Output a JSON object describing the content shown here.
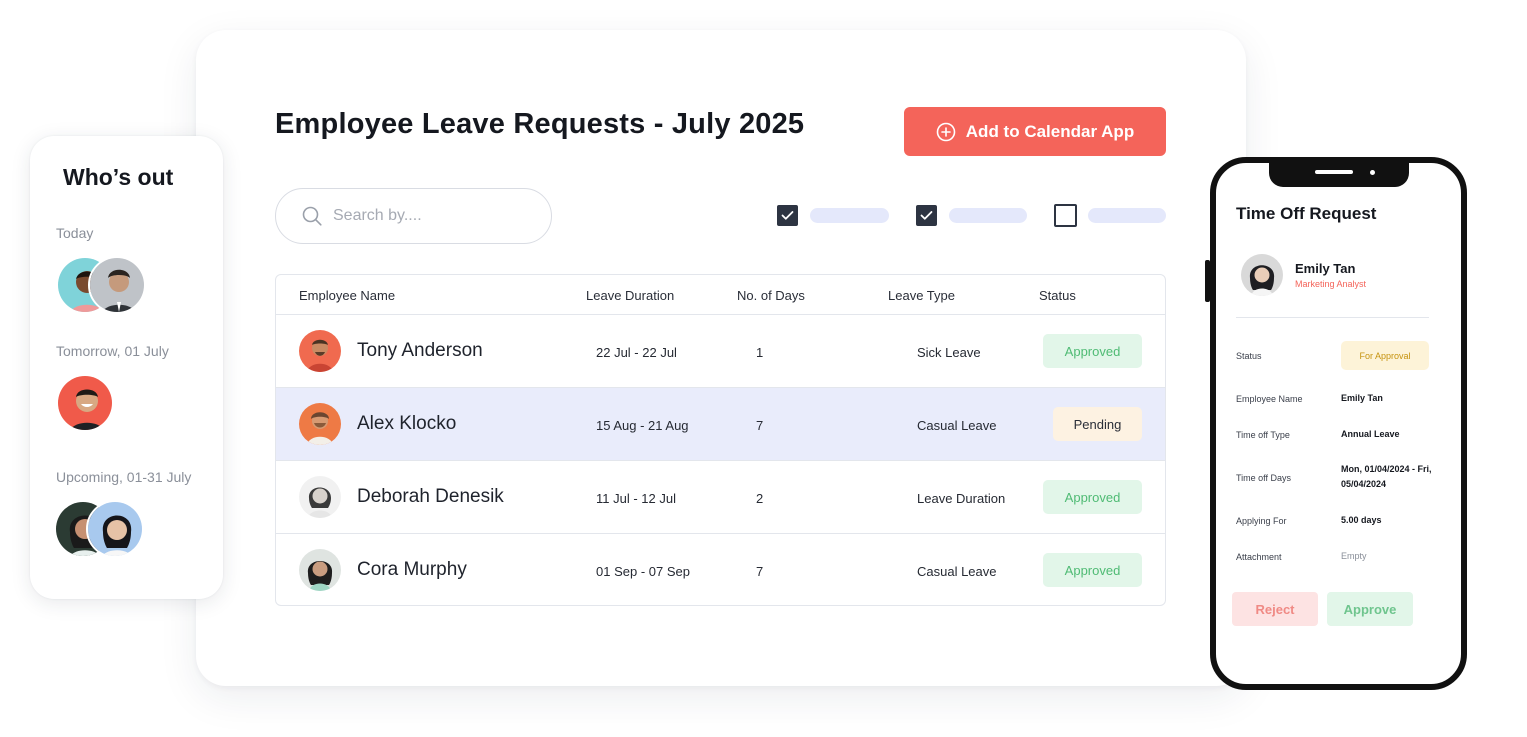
{
  "page": {
    "title": "Employee Leave Requests - July 2025",
    "add_button_label": "Add to Calendar App",
    "search_placeholder": "Search by...."
  },
  "filters": [
    {
      "checked": true
    },
    {
      "checked": true
    },
    {
      "checked": false
    }
  ],
  "table": {
    "headers": [
      "Employee Name",
      "Leave Duration",
      "No. of Days",
      "Leave Type",
      "Status"
    ],
    "rows": [
      {
        "name": "Tony Anderson",
        "duration": "22 Jul - 22 Jul",
        "days": "1",
        "type": "Sick Leave",
        "status": "Approved"
      },
      {
        "name": "Alex Klocko",
        "duration": "15 Aug - 21 Aug",
        "days": "7",
        "type": "Casual Leave",
        "status": "Pending"
      },
      {
        "name": "Deborah Denesik",
        "duration": "11 Jul - 12 Jul",
        "days": "2",
        "type": "Leave Duration",
        "status": "Approved"
      },
      {
        "name": "Cora Murphy",
        "duration": "01 Sep - 07 Sep",
        "days": "7",
        "type": "Casual Leave",
        "status": "Approved"
      }
    ]
  },
  "whos_out": {
    "title": "Who’s out",
    "today_label": "Today",
    "tomorrow_label": "Tomorrow, 01 July",
    "upcoming_label": "Upcoming, 01-31 July"
  },
  "phone": {
    "title": "Time Off Request",
    "employee_name": "Emily Tan",
    "employee_role": "Marketing Analyst",
    "status_label": "Status",
    "status_value": "For Approval",
    "fields": [
      {
        "label": "Employee Name",
        "value": "Emily Tan"
      },
      {
        "label": "Time off Type",
        "value": "Annual Leave"
      },
      {
        "label": "Time off Days",
        "value": "Mon, 01/04/2024 - Fri, 05/04/2024"
      },
      {
        "label": "Applying For",
        "value": "5.00 days"
      },
      {
        "label": "Attachment",
        "value": "Empty"
      }
    ],
    "reject_label": "Reject",
    "approve_label": "Approve"
  },
  "colors": {
    "accent": "#f4645a",
    "approved_bg": "#e2f6e9",
    "approved_text": "#4fbb74",
    "pending_bg": "#fdf2e2",
    "selected_row": "#e9ecfb"
  },
  "icons": {
    "add_button": "plus-circle-icon",
    "search": "search-icon",
    "checkbox": "check-icon"
  }
}
